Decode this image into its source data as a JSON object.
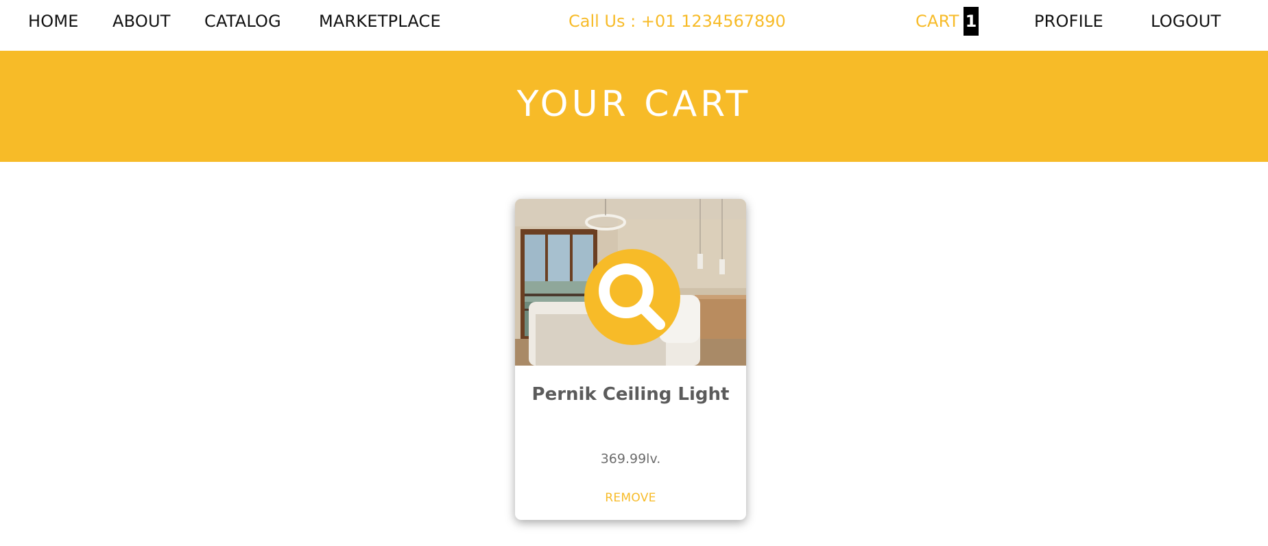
{
  "nav": {
    "home": "HOME",
    "about": "ABOUT",
    "catalog": "CATALOG",
    "marketplace": "MARKETPLACE",
    "phone": "Call Us : +01 1234567890",
    "cart": "CART",
    "cart_count": "1",
    "profile": "PROFILE",
    "logout": "LOGOUT"
  },
  "hero": {
    "title": "YOUR CART"
  },
  "cart_items": [
    {
      "name": "Pernik Ceiling Light",
      "price": "369.99lv.",
      "remove_label": "REMOVE",
      "image_icon": "magnifier-icon"
    }
  ],
  "colors": {
    "accent": "#f7bb28",
    "text": "#111111",
    "badge_bg": "#000000"
  }
}
